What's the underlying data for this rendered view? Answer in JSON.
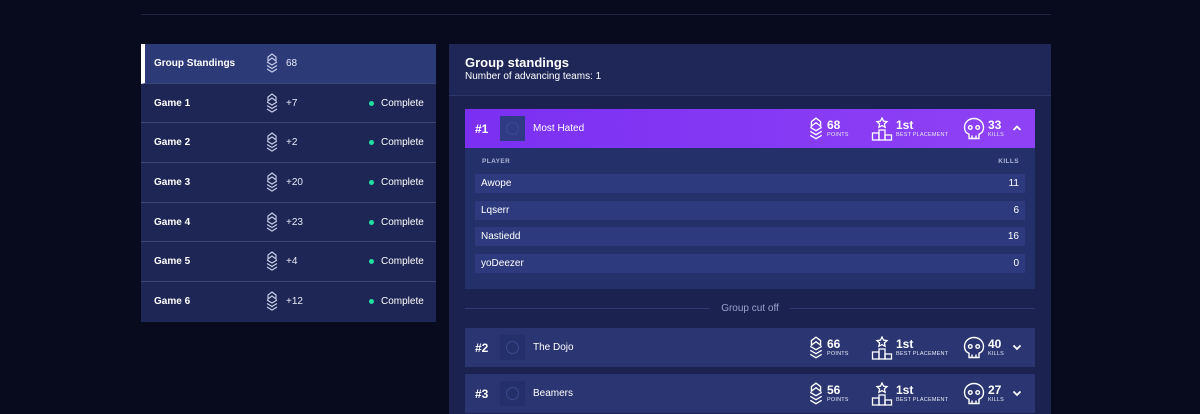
{
  "games": [
    {
      "name": "Group Standings",
      "points": "68",
      "status": "",
      "active": true
    },
    {
      "name": "Game 1",
      "points": "+7",
      "status": "Complete"
    },
    {
      "name": "Game 2",
      "points": "+2",
      "status": "Complete"
    },
    {
      "name": "Game 3",
      "points": "+20",
      "status": "Complete"
    },
    {
      "name": "Game 4",
      "points": "+23",
      "status": "Complete"
    },
    {
      "name": "Game 5",
      "points": "+4",
      "status": "Complete"
    },
    {
      "name": "Game 6",
      "points": "+12",
      "status": "Complete"
    }
  ],
  "panel": {
    "title": "Group standings",
    "subtitle": "Number of advancing teams: 1",
    "cutoff_label": "Group cut off"
  },
  "labels": {
    "points": "POINTS",
    "best_placement": "BEST PLACEMENT",
    "kills": "KILLS",
    "player_col": "PLAYER",
    "kills_col": "KILLS"
  },
  "teams": [
    {
      "rank": "#1",
      "name": "Most Hated",
      "points": "68",
      "best_placement": "1st",
      "kills": "33",
      "expanded": true,
      "players": [
        {
          "name": "Awope",
          "kills": "11"
        },
        {
          "name": "Lqserr",
          "kills": "6"
        },
        {
          "name": "Nastiedd",
          "kills": "16"
        },
        {
          "name": "yoDeezer",
          "kills": "0"
        }
      ]
    },
    {
      "rank": "#2",
      "name": "The Dojo",
      "points": "66",
      "best_placement": "1st",
      "kills": "40",
      "expanded": false
    },
    {
      "rank": "#3",
      "name": "Beamers",
      "points": "56",
      "best_placement": "1st",
      "kills": "27",
      "expanded": false
    }
  ],
  "colors": {
    "background": "#070b1d",
    "panel": "#1b2250",
    "accent_purple": "#7b2ff2",
    "status_green": "#22e0a2"
  },
  "icons": {
    "points": "chevron-badge-icon",
    "placement": "podium-icon",
    "kills": "skull-icon",
    "expand": "chevron-icon"
  }
}
